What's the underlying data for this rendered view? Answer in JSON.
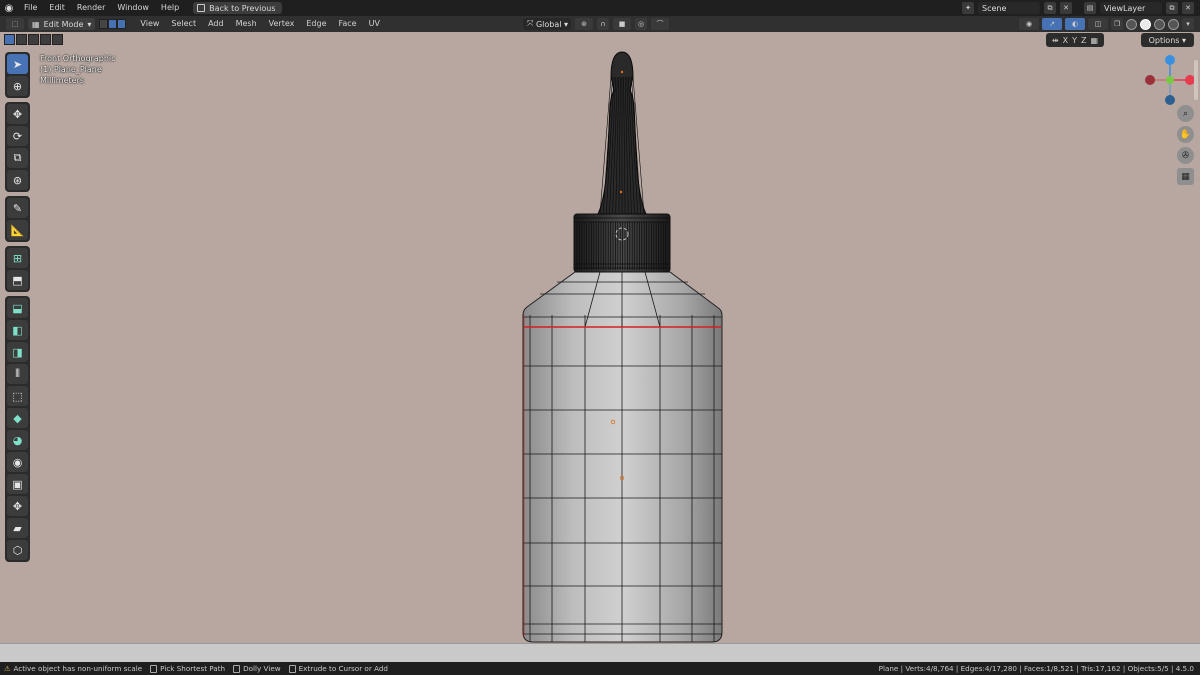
{
  "topbar": {
    "menus": [
      "File",
      "Edit",
      "Render",
      "Window",
      "Help"
    ],
    "back_button": "Back to Previous",
    "scene_label": "Scene",
    "viewlayer_label": "ViewLayer"
  },
  "header": {
    "mode": "Edit Mode",
    "menus": [
      "View",
      "Select",
      "Add",
      "Mesh",
      "Vertex",
      "Edge",
      "Face",
      "UV"
    ],
    "orientation": "Global"
  },
  "viewport": {
    "info_lines": [
      "Front Orthographic",
      "(1) Plane_Plane",
      "Millimeters"
    ],
    "axis_toggles": [
      "X",
      "Y",
      "Z"
    ],
    "options_label": "Options",
    "background_color": "#b7a7a0",
    "selected_edge_color": "#d42020",
    "gizmo_axes": {
      "x": "#e63c4e",
      "y": "#7ac943",
      "z": "#3b8fe0"
    }
  },
  "toolbar": {
    "tools": [
      [
        "select-box-tool",
        "cursor-tool"
      ],
      [
        "move-tool",
        "rotate-tool",
        "scale-tool",
        "transform-tool"
      ],
      [
        "annotate-tool",
        "measure-tool"
      ],
      [
        "add-cube-tool",
        "extrude-region-tool"
      ],
      [
        "inset-faces-tool",
        "bevel-tool",
        "loop-cut-tool",
        "knife-tool",
        "poly-build-tool",
        "spin-tool",
        "smooth-tool",
        "edge-slide-tool",
        "shrink-fatten-tool",
        "shear-tool",
        "rip-region-tool",
        "push-pull-tool"
      ]
    ]
  },
  "status": {
    "warning": "Active object has non-uniform scale",
    "hints": [
      "Pick Shortest Path",
      "Dolly View",
      "Extrude to Cursor or Add"
    ],
    "stats": "Plane | Verts:4/8,764 | Edges:4/17,280 | Faces:1/8,521 | Tris:17,162 | Objects:5/5 | 4.5.0"
  }
}
